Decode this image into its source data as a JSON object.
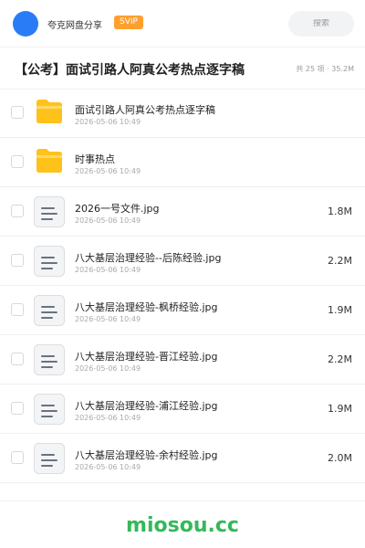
{
  "header": {
    "share_name": "夸克网盘分享",
    "badge": "SVIP",
    "search_placeholder": "搜索",
    "accent_color": "#2a7cf6"
  },
  "folder": {
    "title": "【公考】面试引路人阿真公考热点逐字稿",
    "meta": "共 25 项 · 35.2M"
  },
  "files": [
    {
      "name": "面试引路人阿真公考热点逐字稿",
      "date": "2026-05-06 10:49",
      "size": "",
      "type": "folder"
    },
    {
      "name": "时事热点",
      "date": "2026-05-06 10:49",
      "size": "",
      "type": "folder"
    },
    {
      "name": "2026一号文件.jpg",
      "date": "2026-05-06 10:49",
      "size": "1.8M",
      "type": "file"
    },
    {
      "name": "八大基层治理经验--后陈经验.jpg",
      "date": "2026-05-06 10:49",
      "size": "2.2M",
      "type": "file"
    },
    {
      "name": "八大基层治理经验-枫桥经验.jpg",
      "date": "2026-05-06 10:49",
      "size": "1.9M",
      "type": "file"
    },
    {
      "name": "八大基层治理经验-晋江经验.jpg",
      "date": "2026-05-06 10:49",
      "size": "2.2M",
      "type": "file"
    },
    {
      "name": "八大基层治理经验-浦江经验.jpg",
      "date": "2026-05-06 10:49",
      "size": "1.9M",
      "type": "file"
    },
    {
      "name": "八大基层治理经验-余村经验.jpg",
      "date": "2026-05-06 10:49",
      "size": "2.0M",
      "type": "file"
    }
  ],
  "footer": {
    "brand": "miosou.cc",
    "brand_color": "#34b85a"
  }
}
